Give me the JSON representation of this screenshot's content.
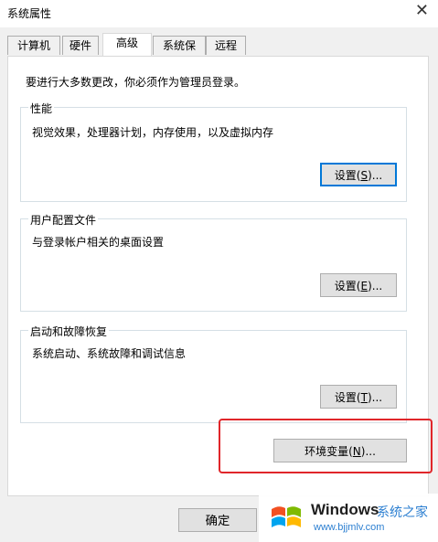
{
  "window": {
    "title": "系统属性",
    "close_glyph": "✕"
  },
  "tabs": [
    {
      "label": "计算机名"
    },
    {
      "label": "硬件"
    },
    {
      "label": "高级"
    },
    {
      "label": "系统保护"
    },
    {
      "label": "远程"
    }
  ],
  "advanced": {
    "admin_note": "要进行大多数更改，你必须作为管理员登录。",
    "performance": {
      "title": "性能",
      "desc": "视觉效果，处理器计划，内存使用，以及虚拟内存",
      "button": {
        "pre": "设置(",
        "key": "S",
        "post": ")..."
      }
    },
    "user_profiles": {
      "title": "用户配置文件",
      "desc": "与登录帐户相关的桌面设置",
      "button": {
        "pre": "设置(",
        "key": "E",
        "post": ")..."
      }
    },
    "startup_recovery": {
      "title": "启动和故障恢复",
      "desc": "系统启动、系统故障和调试信息",
      "button": {
        "pre": "设置(",
        "key": "T",
        "post": ")..."
      }
    },
    "env_vars": {
      "pre": "环境变量(",
      "key": "N",
      "post": ")..."
    }
  },
  "footer": {
    "ok_label": "确定"
  },
  "watermark": {
    "brand": "Windows",
    "site_name": "系统之家",
    "url": "www.bjjmlv.com"
  },
  "colors": {
    "highlight": "#e0262a",
    "focus": "#0078d7",
    "watermark_text": "#2c7fd1"
  }
}
